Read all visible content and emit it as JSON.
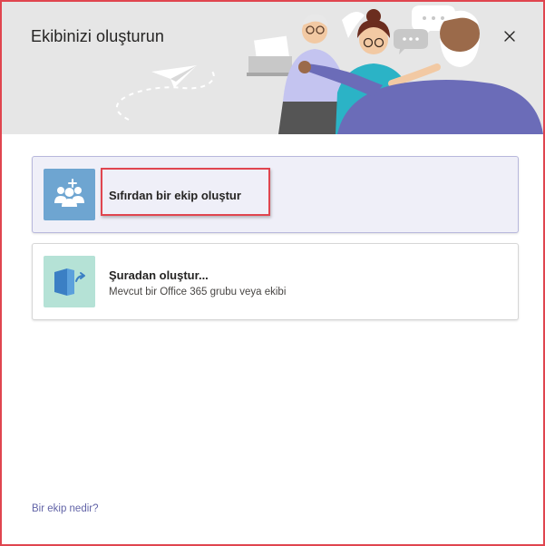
{
  "dialog": {
    "title": "Ekibinizi oluşturun",
    "close_symbol": "✕"
  },
  "options": [
    {
      "title": "Sıfırdan bir ekip oluştur",
      "icon": "team-add-icon",
      "icon_bg": "#6ea5d1",
      "selected": true
    },
    {
      "title": "Şuradan oluştur...",
      "subtitle": "Mevcut bir Office 365 grubu veya ekibi",
      "icon": "office-group-icon",
      "icon_bg": "#b5e2d6",
      "selected": false
    }
  ],
  "footer": {
    "help_link": "Bir ekip nedir?"
  },
  "colors": {
    "accent": "#6264a7",
    "highlight_border": "#e0454f",
    "header_bg": "#e6e6e6"
  }
}
